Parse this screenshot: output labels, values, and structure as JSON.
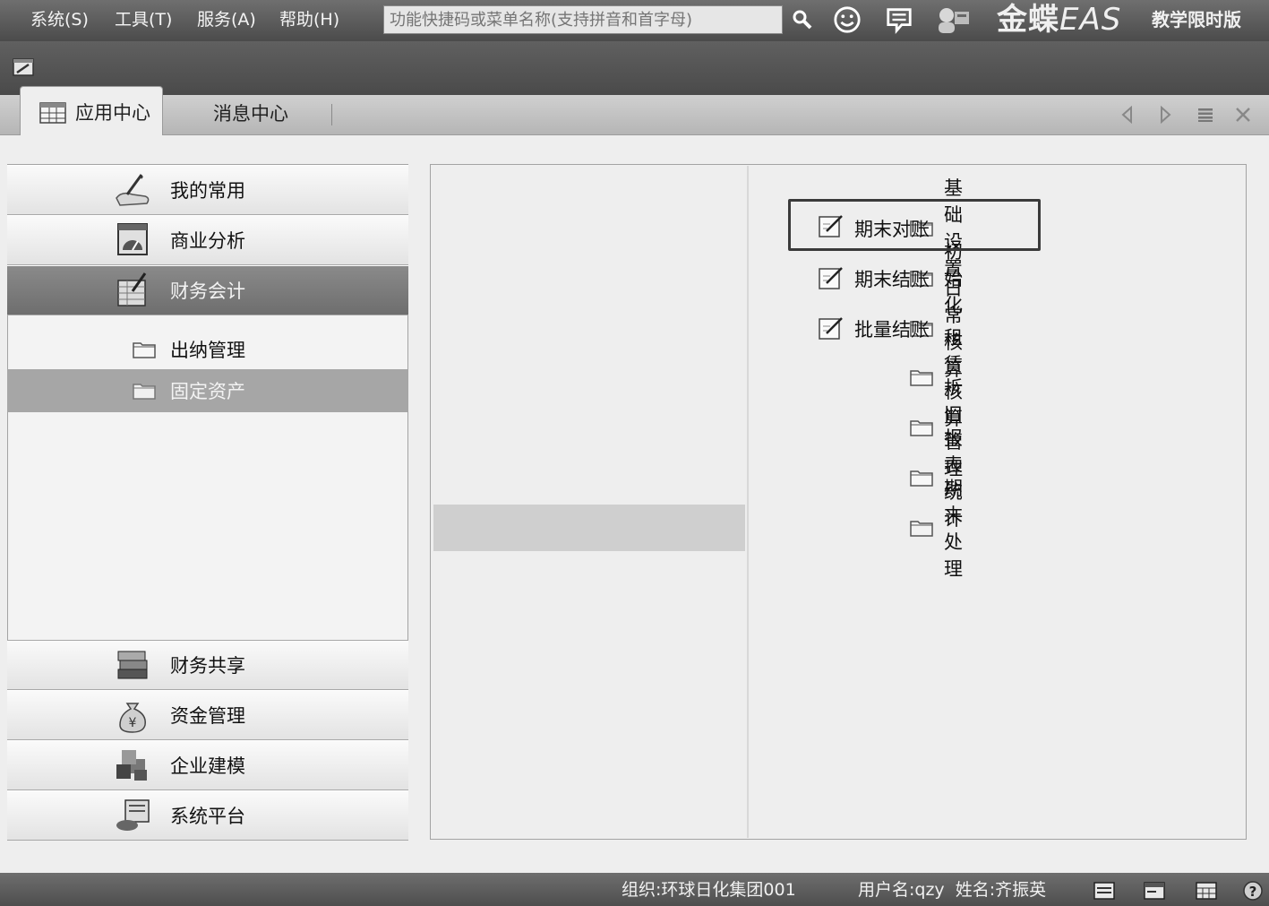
{
  "menubar": {
    "items": [
      "系统(S)",
      "工具(T)",
      "服务(A)",
      "帮助(H)"
    ],
    "search_placeholder": "功能快捷码或菜单名称(支持拼音和首字母)",
    "brand_name": "金蝶",
    "brand_suffix": "EAS",
    "edition": "教学限时版"
  },
  "tabs": [
    {
      "label": "应用中心",
      "active": true
    },
    {
      "label": "消息中心",
      "active": false
    }
  ],
  "sidebar": {
    "top_items": [
      {
        "label": "我的常用",
        "icon": "hand-writing-icon"
      },
      {
        "label": "商业分析",
        "icon": "chart-dashboard-icon"
      },
      {
        "label": "财务会计",
        "icon": "ledger-icon",
        "selected": true
      }
    ],
    "sub_items": [
      {
        "label": "出纳管理",
        "selected": false
      },
      {
        "label": "固定资产",
        "selected": true
      }
    ],
    "bottom_items": [
      {
        "label": "财务共享",
        "icon": "stacked-books-icon"
      },
      {
        "label": "资金管理",
        "icon": "money-bag-icon"
      },
      {
        "label": "企业建模",
        "icon": "cubes-icon"
      },
      {
        "label": "系统平台",
        "icon": "server-icon"
      }
    ]
  },
  "categories": [
    {
      "label": "基础设置",
      "selected": false
    },
    {
      "label": "初始化",
      "selected": false
    },
    {
      "label": "日常核算",
      "selected": false
    },
    {
      "label": "租赁核算",
      "selected": false
    },
    {
      "label": "折旧管理",
      "selected": false
    },
    {
      "label": "报表统计",
      "selected": false
    },
    {
      "label": "期末处理",
      "selected": true
    }
  ],
  "functions": [
    {
      "label": "期末对账",
      "focused": true
    },
    {
      "label": "期末结账",
      "focused": false
    },
    {
      "label": "批量结账",
      "focused": false
    }
  ],
  "status": {
    "org": "组织:环球日化集团001",
    "user": "用户名:qzy  姓名:齐振英"
  },
  "colors": {
    "selected_nav": "#7a7a7a",
    "selected_sub": "#a6a6a6",
    "selected_category": "#cfcfcf"
  }
}
